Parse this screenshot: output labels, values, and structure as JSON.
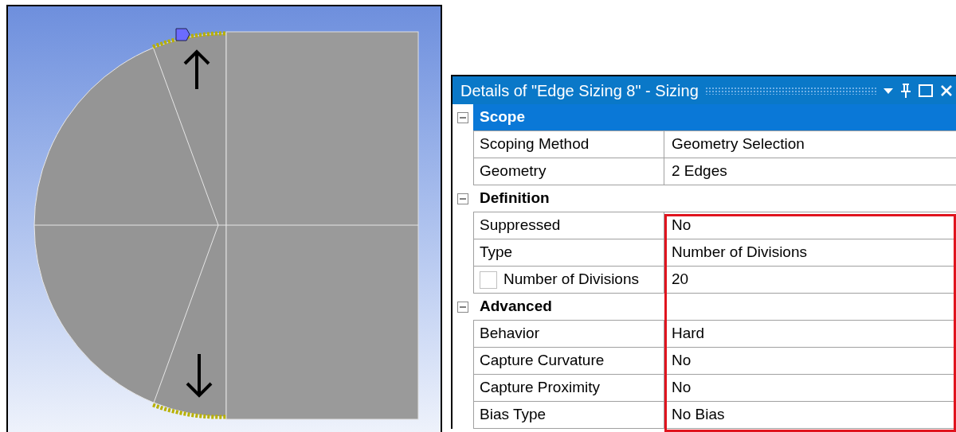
{
  "details_panel": {
    "title": "Details of \"Edge Sizing 8\" - Sizing",
    "groups": [
      {
        "name": "Scope",
        "selected": true,
        "expanded": true,
        "rows": [
          {
            "label": "Scoping Method",
            "value": "Geometry Selection"
          },
          {
            "label": "Geometry",
            "value": "2 Edges"
          }
        ]
      },
      {
        "name": "Definition",
        "selected": false,
        "expanded": true,
        "rows": [
          {
            "label": "Suppressed",
            "value": "No"
          },
          {
            "label": "Type",
            "value": "Number of Divisions"
          },
          {
            "label": "Number of Divisions",
            "value": "20",
            "checked": false
          }
        ]
      },
      {
        "name": "Advanced",
        "selected": false,
        "expanded": true,
        "rows": [
          {
            "label": "Behavior",
            "value": "Hard"
          },
          {
            "label": "Capture Curvature",
            "value": "No"
          },
          {
            "label": "Capture Proximity",
            "value": "No"
          },
          {
            "label": "Bias Type",
            "value": "No Bias"
          }
        ]
      }
    ]
  }
}
